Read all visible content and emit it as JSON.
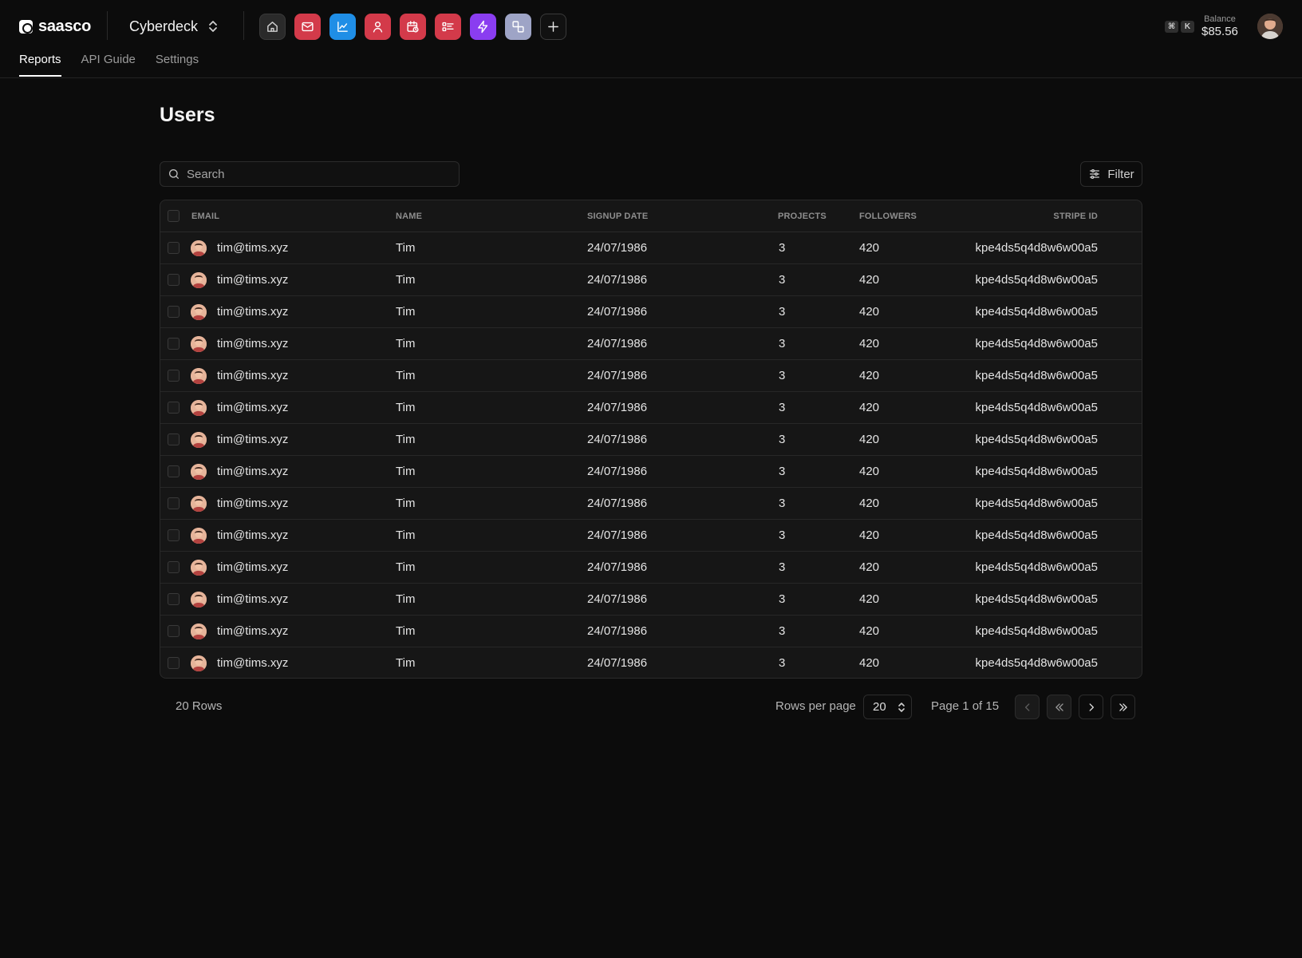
{
  "brand": {
    "name": "saasco"
  },
  "workspace": {
    "name": "Cyberdeck"
  },
  "app_icons": [
    {
      "name": "home",
      "color": "#2a2a2a"
    },
    {
      "name": "mail",
      "color": "#d33a4a"
    },
    {
      "name": "analytics",
      "color": "#1f8ee6"
    },
    {
      "name": "user",
      "color": "#d33a4a"
    },
    {
      "name": "calendar",
      "color": "#d33a4a"
    },
    {
      "name": "checklist",
      "color": "#d33a4a"
    },
    {
      "name": "bolt",
      "color": "#8a3df0"
    },
    {
      "name": "shapes",
      "color": "#9ea4c6"
    },
    {
      "name": "add",
      "color": "#111111"
    }
  ],
  "shortcut": {
    "mod": "⌘",
    "key": "K"
  },
  "balance": {
    "label": "Balance",
    "value": "$85.56"
  },
  "tabs": [
    {
      "label": "Reports",
      "active": true
    },
    {
      "label": "API Guide",
      "active": false
    },
    {
      "label": "Settings",
      "active": false
    }
  ],
  "page": {
    "title": "Users"
  },
  "search": {
    "placeholder": "Search"
  },
  "filter": {
    "label": "Filter"
  },
  "table": {
    "columns": {
      "email": "EMAIL",
      "name": "NAME",
      "signup": "SIGNUP DATE",
      "projects": "PROJECTS",
      "followers": "FOLLOWERS",
      "stripe": "STRIPE ID"
    },
    "rows": [
      {
        "email": "tim@tims.xyz",
        "name": "Tim",
        "signup": "24/07/1986",
        "projects": "3",
        "followers": "420",
        "stripe": "kpe4ds5q4d8w6w00a5"
      },
      {
        "email": "tim@tims.xyz",
        "name": "Tim",
        "signup": "24/07/1986",
        "projects": "3",
        "followers": "420",
        "stripe": "kpe4ds5q4d8w6w00a5"
      },
      {
        "email": "tim@tims.xyz",
        "name": "Tim",
        "signup": "24/07/1986",
        "projects": "3",
        "followers": "420",
        "stripe": "kpe4ds5q4d8w6w00a5"
      },
      {
        "email": "tim@tims.xyz",
        "name": "Tim",
        "signup": "24/07/1986",
        "projects": "3",
        "followers": "420",
        "stripe": "kpe4ds5q4d8w6w00a5"
      },
      {
        "email": "tim@tims.xyz",
        "name": "Tim",
        "signup": "24/07/1986",
        "projects": "3",
        "followers": "420",
        "stripe": "kpe4ds5q4d8w6w00a5"
      },
      {
        "email": "tim@tims.xyz",
        "name": "Tim",
        "signup": "24/07/1986",
        "projects": "3",
        "followers": "420",
        "stripe": "kpe4ds5q4d8w6w00a5"
      },
      {
        "email": "tim@tims.xyz",
        "name": "Tim",
        "signup": "24/07/1986",
        "projects": "3",
        "followers": "420",
        "stripe": "kpe4ds5q4d8w6w00a5"
      },
      {
        "email": "tim@tims.xyz",
        "name": "Tim",
        "signup": "24/07/1986",
        "projects": "3",
        "followers": "420",
        "stripe": "kpe4ds5q4d8w6w00a5"
      },
      {
        "email": "tim@tims.xyz",
        "name": "Tim",
        "signup": "24/07/1986",
        "projects": "3",
        "followers": "420",
        "stripe": "kpe4ds5q4d8w6w00a5"
      },
      {
        "email": "tim@tims.xyz",
        "name": "Tim",
        "signup": "24/07/1986",
        "projects": "3",
        "followers": "420",
        "stripe": "kpe4ds5q4d8w6w00a5"
      },
      {
        "email": "tim@tims.xyz",
        "name": "Tim",
        "signup": "24/07/1986",
        "projects": "3",
        "followers": "420",
        "stripe": "kpe4ds5q4d8w6w00a5"
      },
      {
        "email": "tim@tims.xyz",
        "name": "Tim",
        "signup": "24/07/1986",
        "projects": "3",
        "followers": "420",
        "stripe": "kpe4ds5q4d8w6w00a5"
      },
      {
        "email": "tim@tims.xyz",
        "name": "Tim",
        "signup": "24/07/1986",
        "projects": "3",
        "followers": "420",
        "stripe": "kpe4ds5q4d8w6w00a5"
      },
      {
        "email": "tim@tims.xyz",
        "name": "Tim",
        "signup": "24/07/1986",
        "projects": "3",
        "followers": "420",
        "stripe": "kpe4ds5q4d8w6w00a5"
      }
    ]
  },
  "pagination": {
    "total_rows": "20 Rows",
    "rows_per_page_label": "Rows per page",
    "rows_per_page_value": "20",
    "page_info": "Page 1 of 15"
  }
}
